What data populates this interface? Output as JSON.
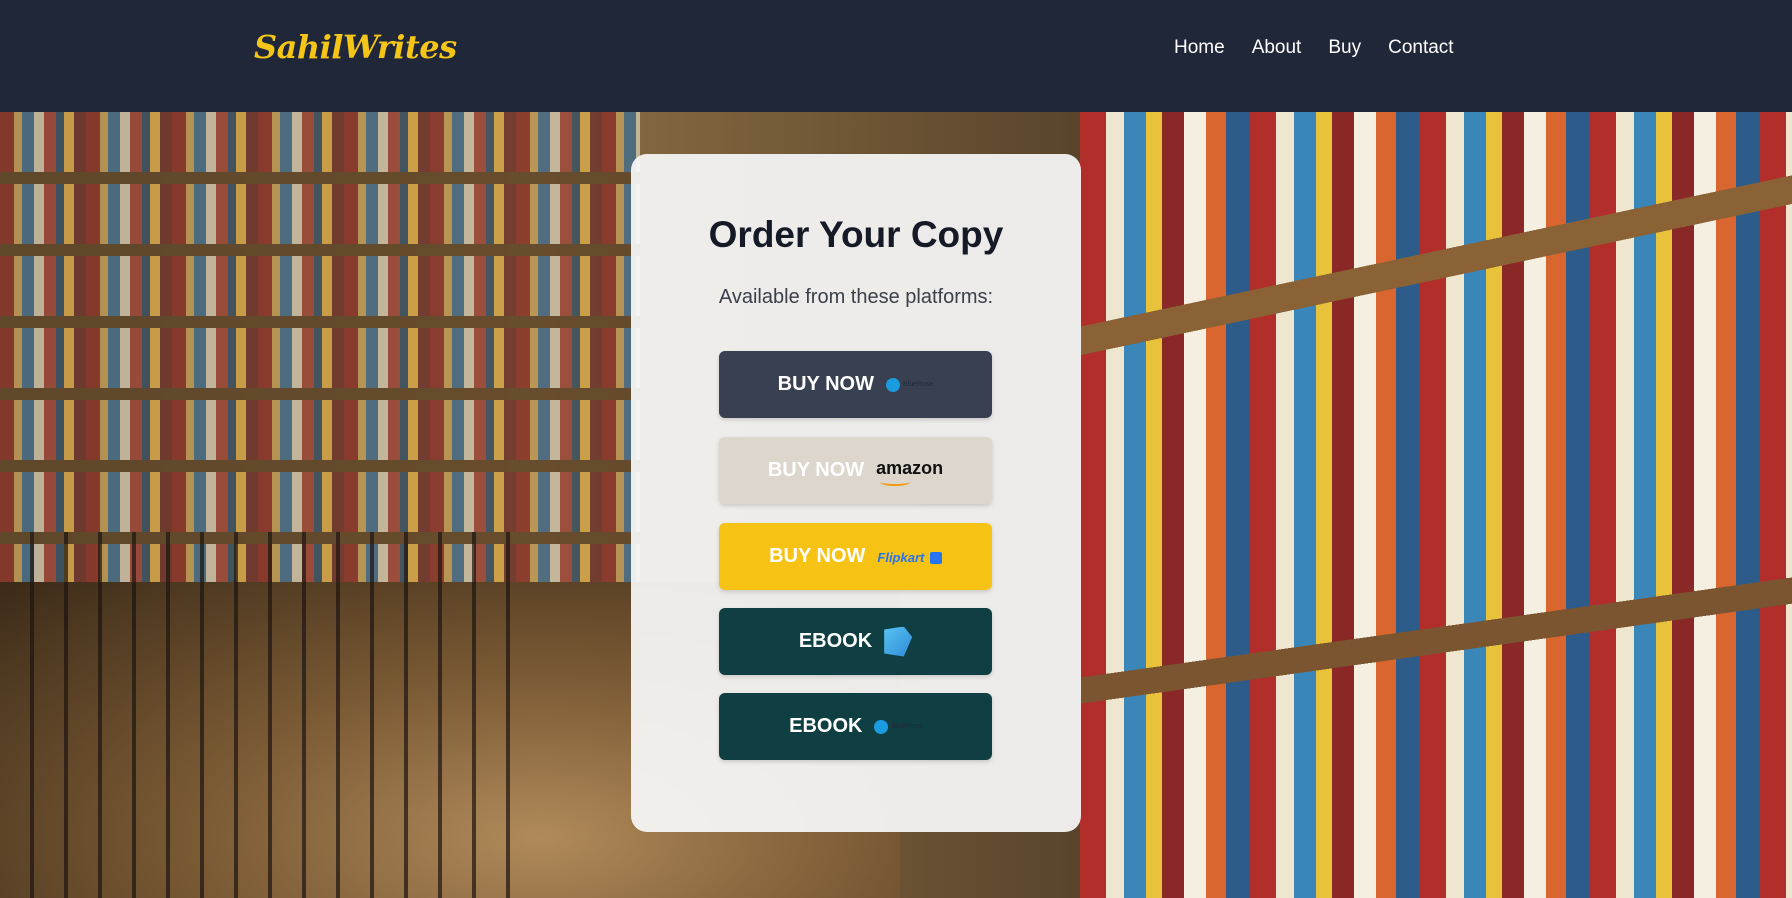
{
  "header": {
    "logo": "SahilWrites",
    "nav": [
      "Home",
      "About",
      "Buy",
      "Contact"
    ]
  },
  "card": {
    "title": "Order Your Copy",
    "subtitle": "Available from these platforms:",
    "buttons": [
      {
        "label": "BUY NOW",
        "platform": "BlueRose",
        "icon": "bluerose-logo-icon",
        "color": "#394052"
      },
      {
        "label": "BUY NOW",
        "platform": "amazon",
        "icon": "amazon-logo-icon",
        "color": "#ddd6cd"
      },
      {
        "label": "BUY NOW",
        "platform": "Flipkart",
        "icon": "flipkart-logo-icon",
        "color": "#f6c315"
      },
      {
        "label": "EBOOK",
        "platform": "Google Play Books",
        "icon": "google-play-books-icon",
        "color": "#0f3f42"
      },
      {
        "label": "EBOOK",
        "platform": "BlueRose",
        "icon": "bluerose-logo-icon",
        "color": "#0f3f42"
      }
    ]
  },
  "colors": {
    "header_bg": "#1f2738",
    "logo": "#f5c518"
  }
}
